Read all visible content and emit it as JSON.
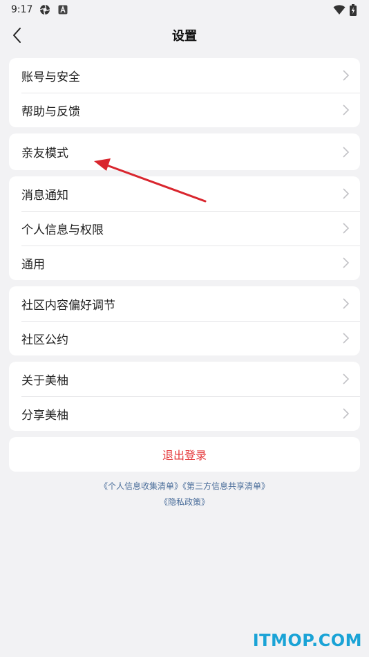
{
  "status": {
    "time": "9:17"
  },
  "nav": {
    "title": "设置"
  },
  "groups": [
    {
      "items": [
        "账号与安全",
        "帮助与反馈"
      ]
    },
    {
      "items": [
        "亲友模式"
      ]
    },
    {
      "items": [
        "消息通知",
        "个人信息与权限",
        "通用"
      ]
    },
    {
      "items": [
        "社区内容偏好调节",
        "社区公约"
      ]
    },
    {
      "items": [
        "关于美柚",
        "分享美柚"
      ]
    }
  ],
  "logout": {
    "label": "退出登录"
  },
  "footer_links": {
    "info_list": "《个人信息收集清单》",
    "third_party": "《第三方信息共享清单》",
    "privacy": "《隐私政策》"
  },
  "watermark": "ITMOP.COM",
  "colors": {
    "logout": "#e5383b",
    "link": "#4a6d9a",
    "annotation_arrow": "#d9262e"
  }
}
